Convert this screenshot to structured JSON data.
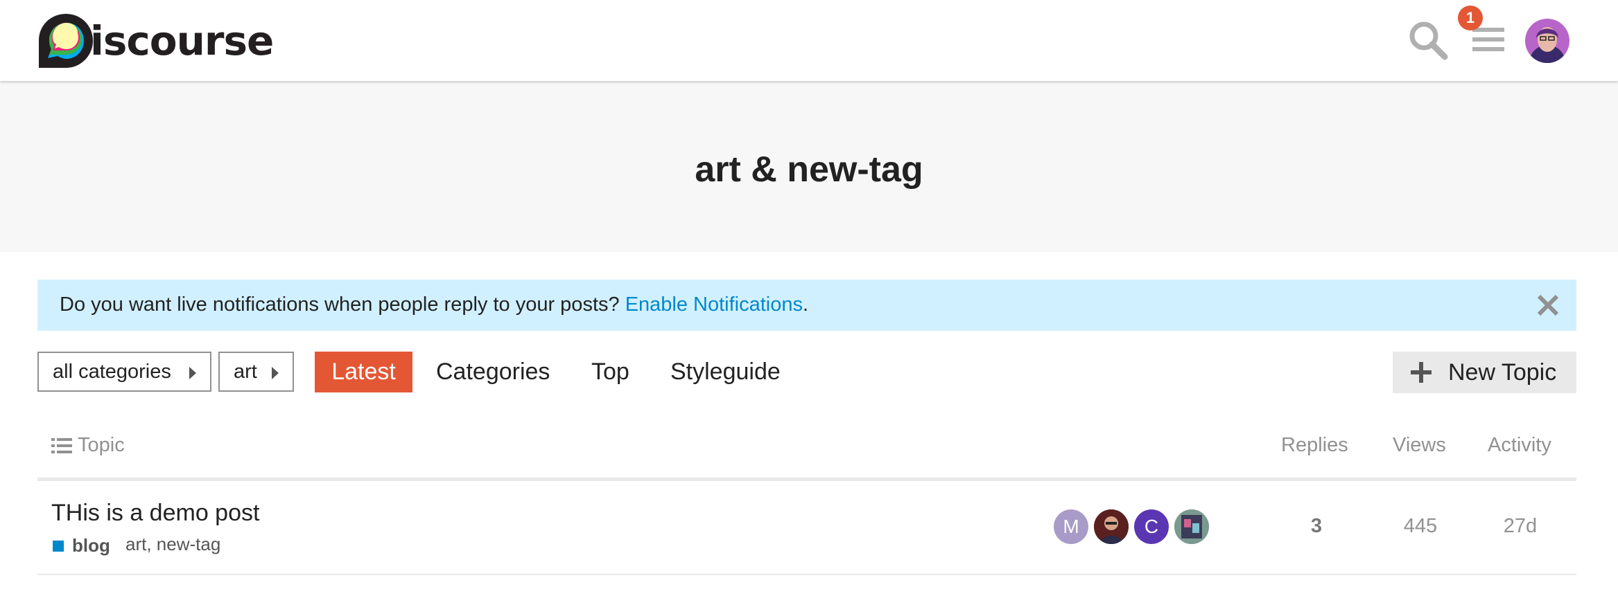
{
  "header": {
    "logo_text": "iscourse",
    "notification_count": "1",
    "icons": [
      "search-icon",
      "hamburger-menu-icon",
      "user-avatar"
    ]
  },
  "banner": {
    "title": "art & new-tag"
  },
  "notify_bar": {
    "message": "Do you want live notifications when people reply to your posts? ",
    "link_label": "Enable Notifications",
    "suffix": "."
  },
  "nav": {
    "crumbs": [
      {
        "label": "all categories"
      },
      {
        "label": "art"
      }
    ],
    "items": [
      {
        "label": "Latest",
        "active": true
      },
      {
        "label": "Categories"
      },
      {
        "label": "Top"
      },
      {
        "label": "Styleguide"
      }
    ],
    "new_topic_label": "New Topic"
  },
  "table": {
    "headers": {
      "topic": "Topic",
      "replies": "Replies",
      "views": "Views",
      "activity": "Activity"
    },
    "rows": [
      {
        "title": "THis is a demo post",
        "category": "blog",
        "category_color": "#0088cc",
        "tags": [
          "art",
          "new-tag"
        ],
        "posters": [
          {
            "initial": "M",
            "color": "#a99bc7"
          },
          {
            "initial": "",
            "color": "#6d2b2b"
          },
          {
            "initial": "C",
            "color": "#5b36b3"
          },
          {
            "initial": "",
            "color": "#6b8a80"
          }
        ],
        "replies": "3",
        "views": "445",
        "activity": "27d"
      }
    ]
  },
  "colors": {
    "accent": "#e45735",
    "link": "#0088cc",
    "notify_bg": "#d1f0ff"
  }
}
